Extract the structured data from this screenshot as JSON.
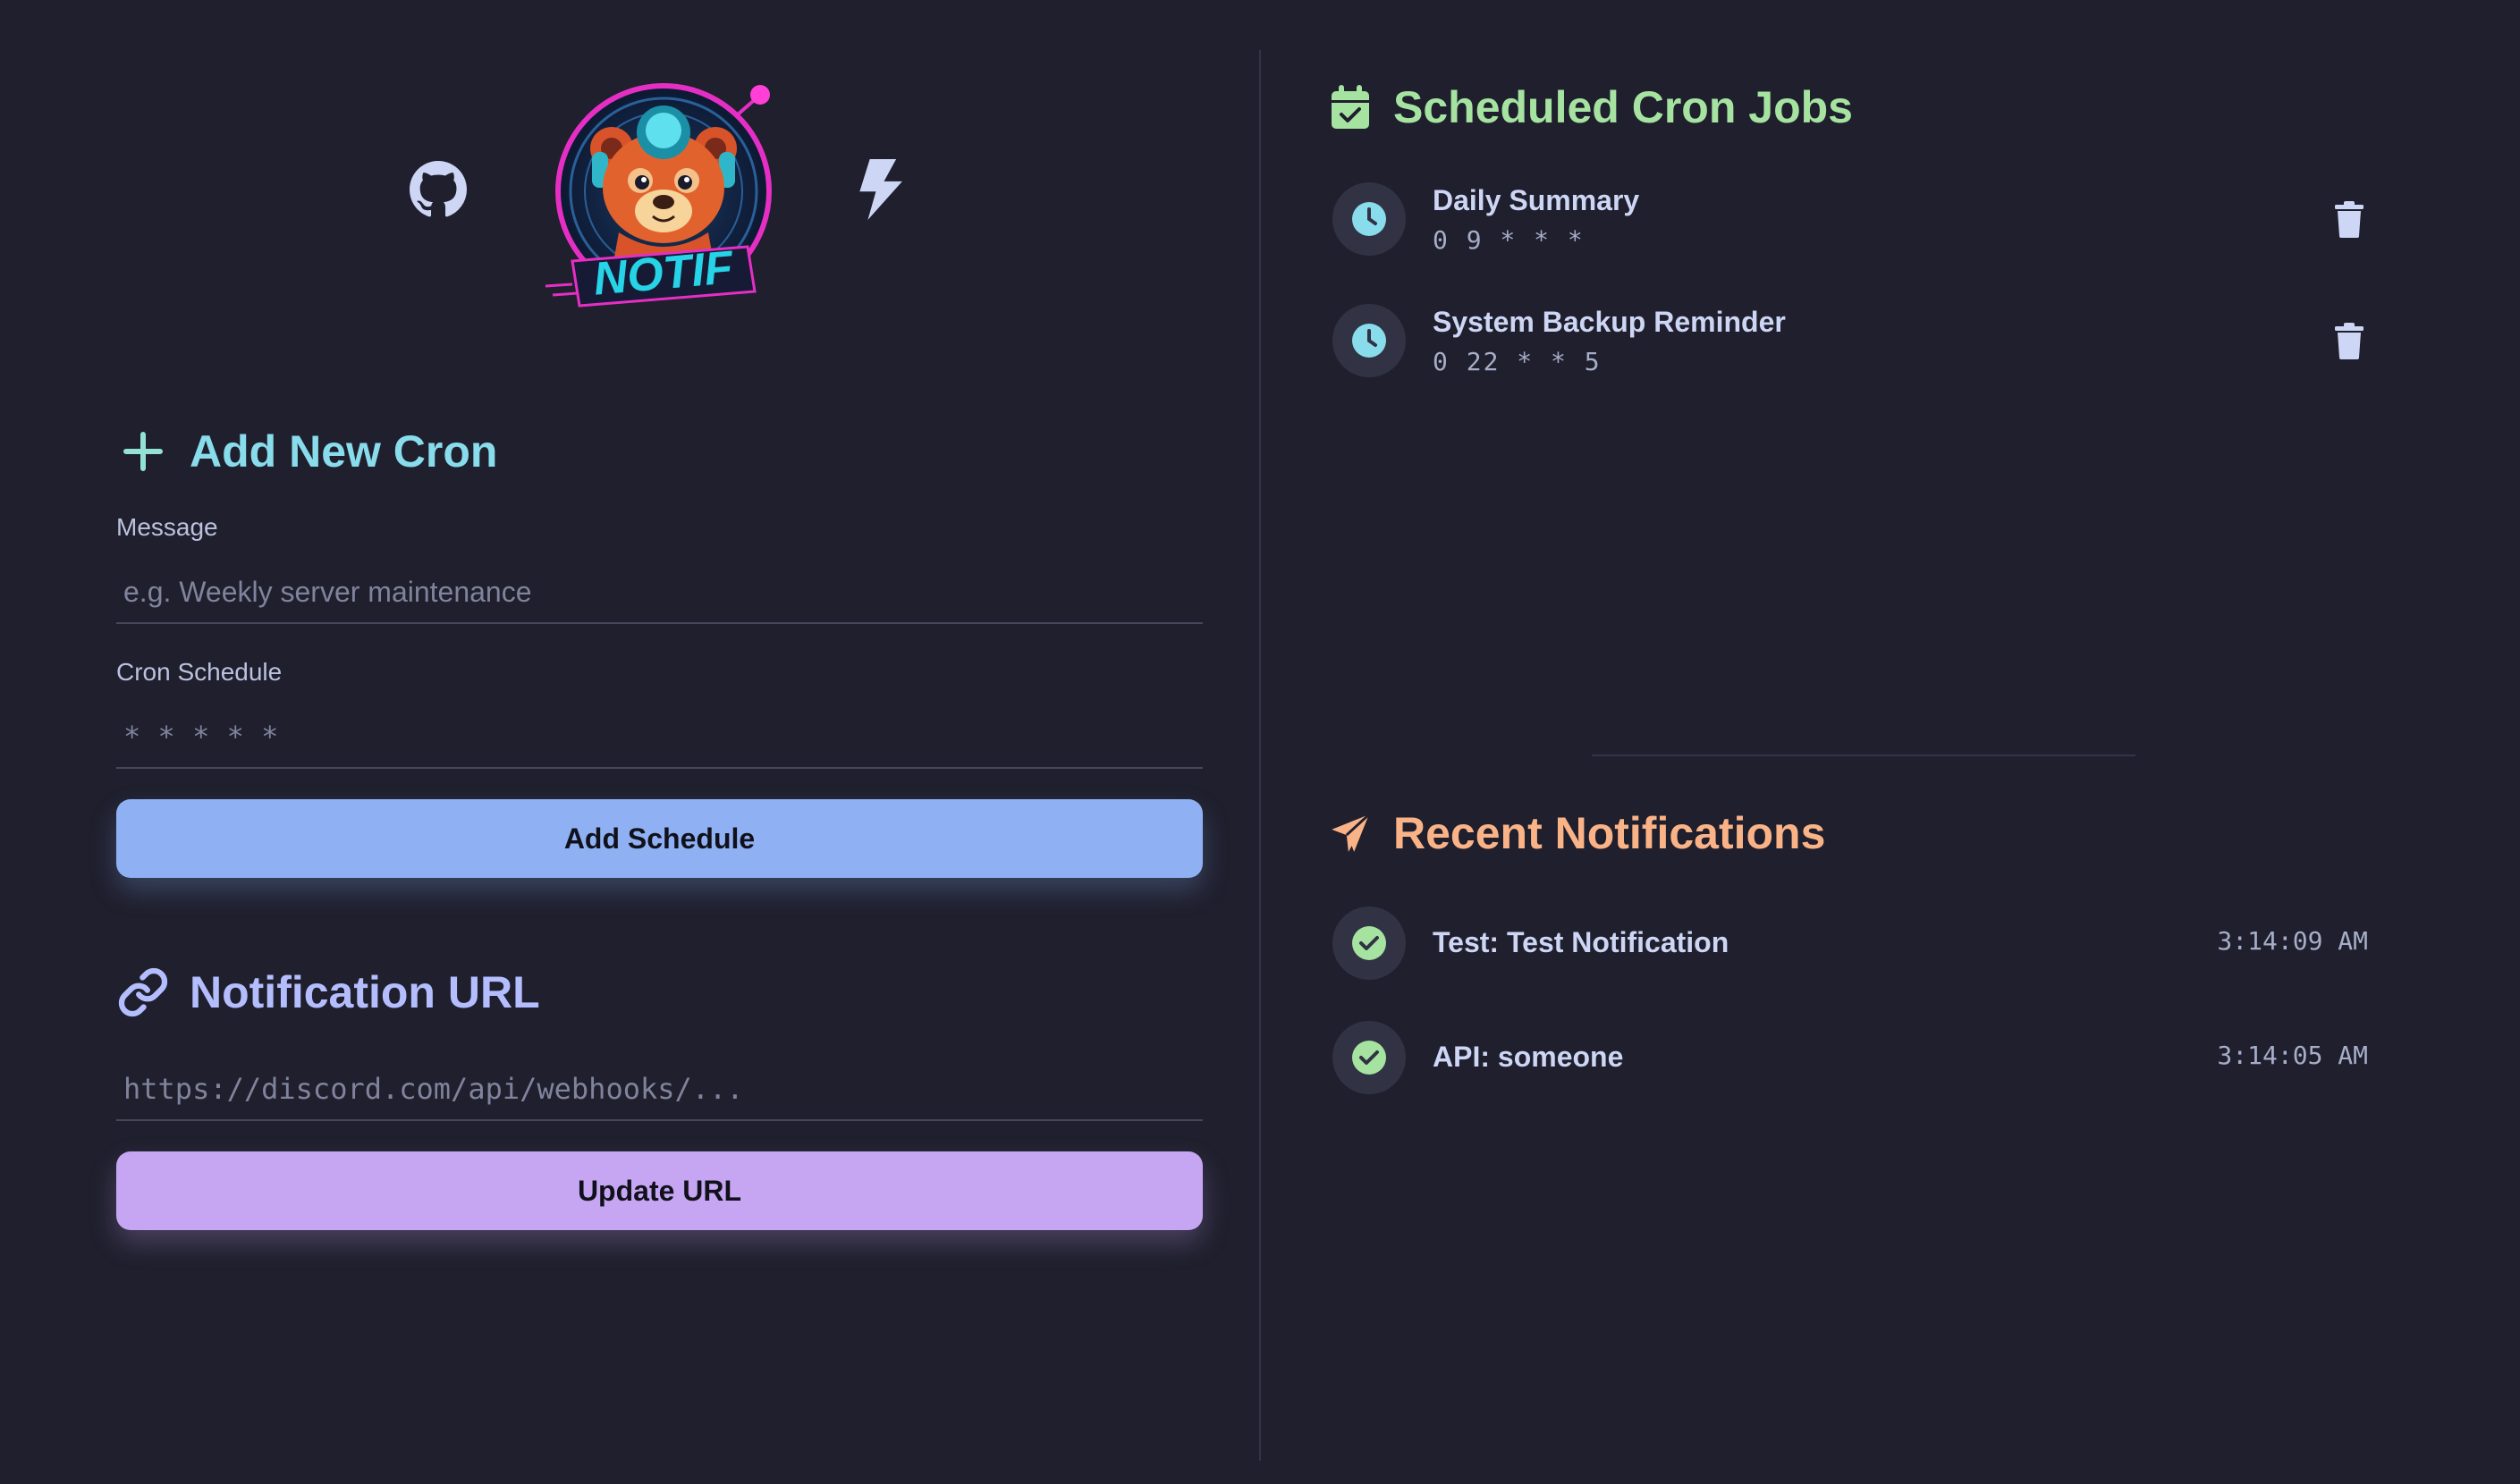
{
  "header": {
    "logo_text": "NOTIF"
  },
  "add_cron": {
    "title": "Add New Cron",
    "message_label": "Message",
    "message_placeholder": "e.g. Weekly server maintenance",
    "schedule_label": "Cron Schedule",
    "schedule_placeholder": "* * * * *",
    "button_label": "Add Schedule"
  },
  "notification_url": {
    "title": "Notification URL",
    "placeholder": "https://discord.com/api/webhooks/...",
    "button_label": "Update URL"
  },
  "scheduled": {
    "title": "Scheduled Cron Jobs",
    "jobs": [
      {
        "name": "Daily Summary",
        "schedule": "0 9 * * *"
      },
      {
        "name": "System Backup Reminder",
        "schedule": "0 22 * * 5"
      }
    ]
  },
  "recent": {
    "title": "Recent Notifications",
    "items": [
      {
        "text": "Test: Test Notification",
        "time": "3:14:09 AM"
      },
      {
        "text": "API: someone",
        "time": "3:14:05 AM"
      }
    ]
  },
  "colors": {
    "background": "#1f1f2d",
    "teal": "#94e2d5",
    "sky": "#89dceb",
    "green": "#a6e3a1",
    "peach": "#fab387",
    "lavender": "#b4befe",
    "blue_button": "#8fb1f4",
    "purple_button": "#c6a6f3"
  }
}
